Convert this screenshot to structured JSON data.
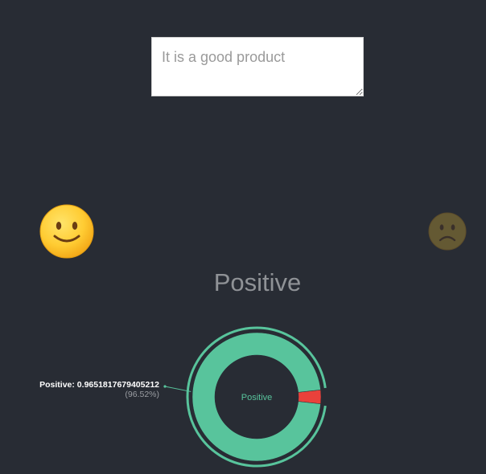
{
  "input": {
    "placeholder": "It is a good product"
  },
  "emojis": {
    "positive": "smiling-face",
    "negative": "frowning-face"
  },
  "result": {
    "label": "Positive"
  },
  "chart_data": {
    "type": "pie",
    "center_label": "Positive",
    "categories": [
      "Positive",
      "Negative"
    ],
    "values": [
      0.9651817679405212,
      0.0348182320594788
    ],
    "colors": [
      "#58c49c",
      "#e9413b"
    ],
    "tooltip": {
      "label": "Positive: 0.9651817679405212",
      "percent": "(96.52%)"
    }
  }
}
